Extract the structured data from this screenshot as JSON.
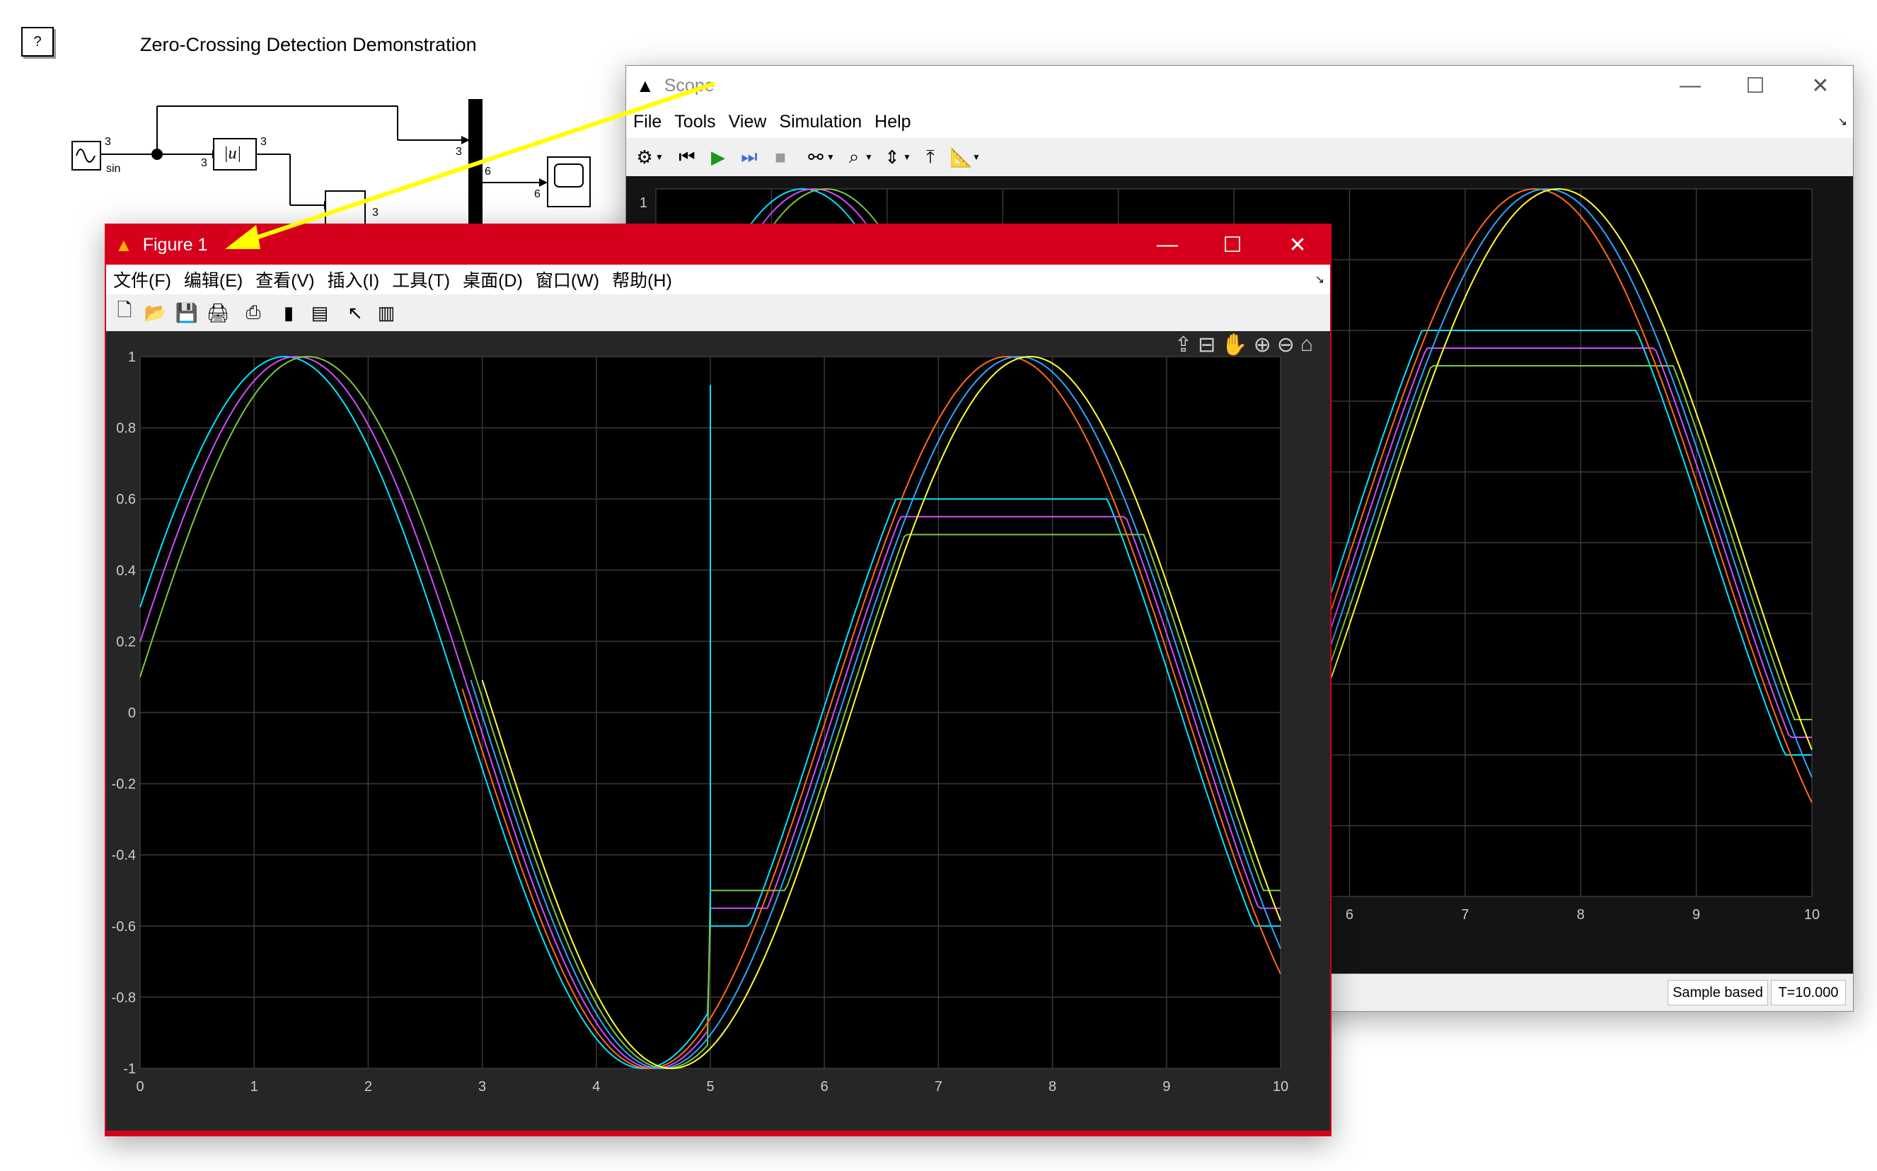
{
  "model": {
    "help_label": "?",
    "title": "Zero-Crossing Detection Demonstration",
    "sine_block_label": "sin",
    "port_widths": [
      "3",
      "3",
      "3",
      "3",
      "3",
      "6",
      "6"
    ],
    "abs_block_label": "|u|"
  },
  "scope": {
    "title": "Scope",
    "menu": [
      "File",
      "Tools",
      "View",
      "Simulation",
      "Help"
    ],
    "toolbar_icons": [
      "settings-icon",
      "step-back-icon",
      "run-icon",
      "step-forward-icon",
      "stop-icon",
      "highlight-icon",
      "zoom-icon",
      "scale-icon",
      "trigger-icon",
      "measure-icon"
    ],
    "y_tick_visible": "1",
    "x_ticks": [
      "6",
      "7",
      "8",
      "9",
      "10"
    ],
    "status": {
      "mode": "Sample based",
      "time": "T=10.000"
    }
  },
  "figure": {
    "title": "Figure 1",
    "menu": [
      "文件(F)",
      "编辑(E)",
      "查看(V)",
      "插入(I)",
      "工具(T)",
      "桌面(D)",
      "窗口(W)",
      "帮助(H)"
    ],
    "toolbar_icons": [
      "new-icon",
      "open-icon",
      "save-icon",
      "print-icon",
      "print-preview-icon",
      "colorbar-icon",
      "legend-icon",
      "pointer-icon",
      "property-editor-icon"
    ],
    "axes_toolbar_icons": [
      "export-icon",
      "brush-icon",
      "pan-icon",
      "zoom-in-icon",
      "zoom-out-icon",
      "home-icon"
    ]
  },
  "colors": {
    "figure_frame": "#d6001c",
    "plot_bg": "#000000",
    "grid": "#3a3a3a",
    "series_cyan": "#00e5ff",
    "series_magenta": "#d24dff",
    "series_green": "#7cc93b",
    "series_orange": "#ff6a1a",
    "series_blue": "#2aa6ff",
    "series_yellow": "#ffff33",
    "annotation_arrow": "#ffff00"
  },
  "chart_data": [
    {
      "type": "line",
      "title": "",
      "xlabel": "",
      "ylabel": "",
      "xlim": [
        0,
        10
      ],
      "ylim": [
        -1,
        1
      ],
      "x_ticks": [
        "0",
        "1",
        "2",
        "3",
        "4",
        "5",
        "6",
        "7",
        "8",
        "9",
        "10"
      ],
      "y_ticks": [
        "1",
        "0.8",
        "0.6",
        "0.4",
        "0.2",
        "0",
        "-0.2",
        "-0.4",
        "-0.6",
        "-0.8",
        "-1"
      ],
      "grid": true,
      "series": [
        {
          "color": "cyan",
          "phase": 0.3,
          "saturate_lo": -0.6,
          "saturate_hi": 0.6
        },
        {
          "color": "magenta",
          "phase": 0.2,
          "saturate_lo": -0.55,
          "saturate_hi": 0.55
        },
        {
          "color": "green",
          "phase": 0.1,
          "saturate_lo": -0.5,
          "saturate_hi": 0.5
        },
        {
          "color": "orange",
          "phase": 0.3,
          "abs_segment": true
        },
        {
          "color": "blue",
          "phase": 0.2,
          "abs_segment": true
        },
        {
          "color": "yellow",
          "phase": 0.1,
          "abs_segment": true
        }
      ]
    }
  ]
}
